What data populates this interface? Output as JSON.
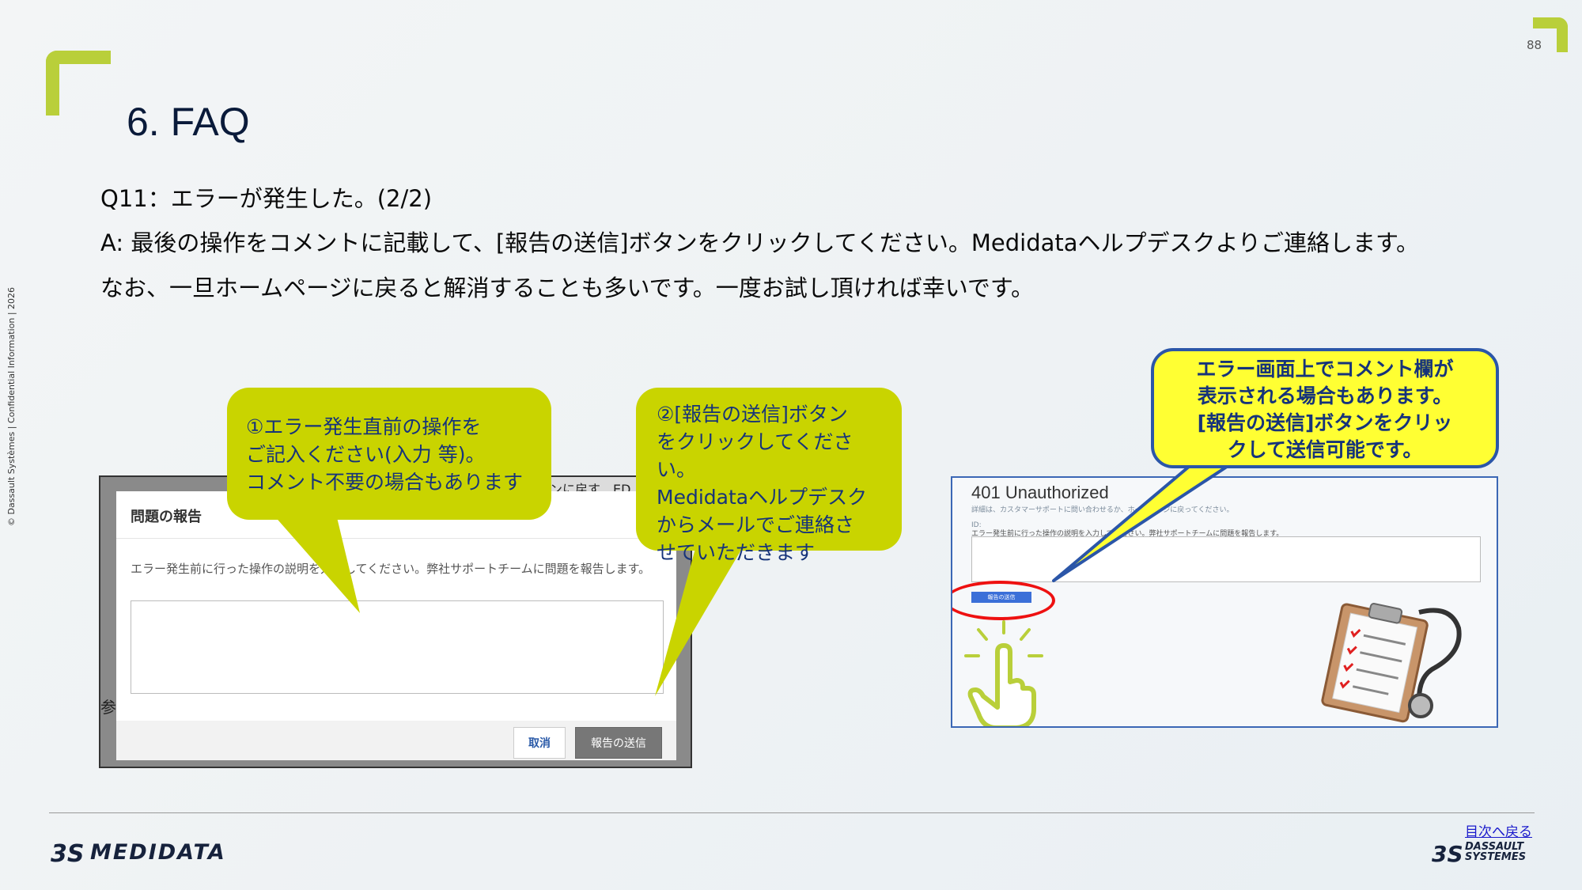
{
  "slide": {
    "page_number": "88",
    "title": "6. FAQ",
    "side_note": "© Dassault Systèmes | Confidential Information | 2026",
    "question": "Q11：エラーが発生した。(2/2)",
    "answer": "A: 最後の操作をコメントに記載して、[報告の送信]ボタンをクリックしてください。Medidataヘルプデスクよりご連絡します。",
    "note": "なお、一旦ホームページに戻ると解消することも多いです。一度お試し頂ければ幸いです。"
  },
  "left_screenshot": {
    "behind_text": "ンに戻す　ED",
    "behind_side": "参",
    "dialog_title": "問題の報告",
    "dialog_desc": "エラー発生前に行った操作の説明を入力してください。弊社サポートチームに問題を報告します。",
    "cancel_label": "取消",
    "send_label": "報告の送信"
  },
  "right_screenshot": {
    "error_title": "401 Unauthorized",
    "line1": "詳細は、カスタマーサポートに問い合わせるか、ホームページに戻ってください。",
    "line2": "ID:",
    "line3": "エラー発生前に行った操作の説明を入力してください。弊社サポートチームに問題を報告します。",
    "send_label": "報告の送信"
  },
  "callouts": {
    "c1": [
      "①エラー発生直前の操作を",
      "ご記入ください(入力 等)。",
      "コメント不要の場合もあります"
    ],
    "c2": [
      "②[報告の送信]ボタン",
      "をクリックしてください。",
      "Medidataヘルプデスク",
      "からメールでご連絡さ",
      "せていただきます"
    ],
    "c3": [
      "エラー画面上でコメント欄が",
      "表示される場合もあります。",
      "[報告の送信]ボタンをクリッ",
      "クして送信可能です。"
    ]
  },
  "footer": {
    "back_link": "目次へ戻る",
    "logo_left": "MEDIDATA",
    "logo_right_1": "DASSAULT",
    "logo_right_2": "SYSTEMES"
  },
  "colors": {
    "accent_green": "#b9cf3a",
    "callout_green": "#c9d400",
    "callout_yellow": "#ffff33",
    "callout_text": "#16337a",
    "highlight_red": "#e11111"
  }
}
